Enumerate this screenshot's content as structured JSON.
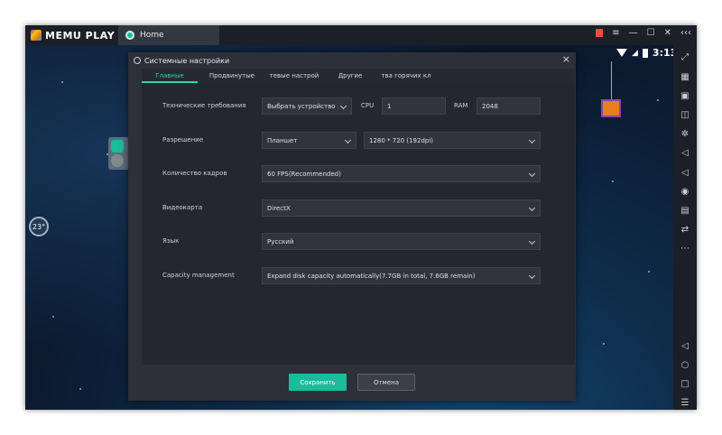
{
  "app": {
    "logo_text": "MEMU PLAY",
    "home_tab": "Home"
  },
  "window_controls": {
    "more": "‹‹‹"
  },
  "android_status": {
    "time": "3:13"
  },
  "widget": {
    "percent": "23°"
  },
  "dialog": {
    "title": "Системные настройки",
    "close": "×",
    "tabs": [
      {
        "label": "Главные",
        "active": true
      },
      {
        "label": "Продвинутые",
        "active": false
      },
      {
        "label": "тевые настрой",
        "active": false
      },
      {
        "label": "Другие",
        "active": false
      },
      {
        "label": "тва горячих кл",
        "active": false
      }
    ],
    "fields": {
      "tech": {
        "label": "Технические требования",
        "device": "Выбрать устройство",
        "cpu_label": "CPU",
        "cpu": "1",
        "ram_label": "RAM",
        "ram": "2048"
      },
      "resolution": {
        "label": "Разрешение",
        "mode": "Планшет",
        "size": "1280 * 720 (192dpi)"
      },
      "fps": {
        "label": "Количество кадров",
        "value": "60 FPS(Recommended)"
      },
      "gpu": {
        "label": "Видеокарта",
        "value": "DirectX"
      },
      "lang": {
        "label": "Язык",
        "value": "Русский"
      },
      "capacity": {
        "label": "Capacity management",
        "value": "Expand disk capacity automatically(7.7GB in total, 7.6GB remain)"
      }
    },
    "buttons": {
      "save": "Сохранить",
      "cancel": "Отмена"
    }
  },
  "colors": {
    "accent": "#1abc9c",
    "background": "#0c1a30",
    "dialog": "#2b3039"
  }
}
